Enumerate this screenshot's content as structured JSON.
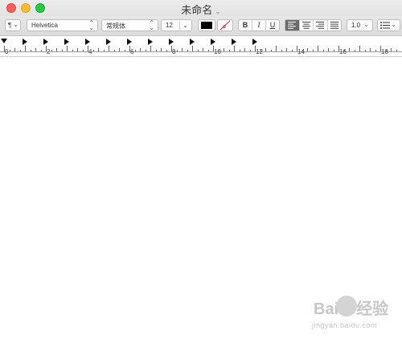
{
  "window": {
    "title": "未命名"
  },
  "toolbar": {
    "paragraph_style": "¶",
    "font_family": "Helvetica",
    "font_style": "常规体",
    "font_size": "12",
    "bold": "B",
    "italic": "I",
    "underline": "U",
    "line_spacing": "1.0",
    "text_color": "#000000",
    "active_alignment": "left"
  },
  "ruler": {
    "numbers": [
      "0",
      "2",
      "4",
      "6",
      "8",
      "10",
      "12",
      "14",
      "16",
      "18"
    ]
  },
  "watermark": {
    "brand": "Bai",
    "brand_suffix": "经验",
    "site": "jingyan.baidu.com"
  }
}
